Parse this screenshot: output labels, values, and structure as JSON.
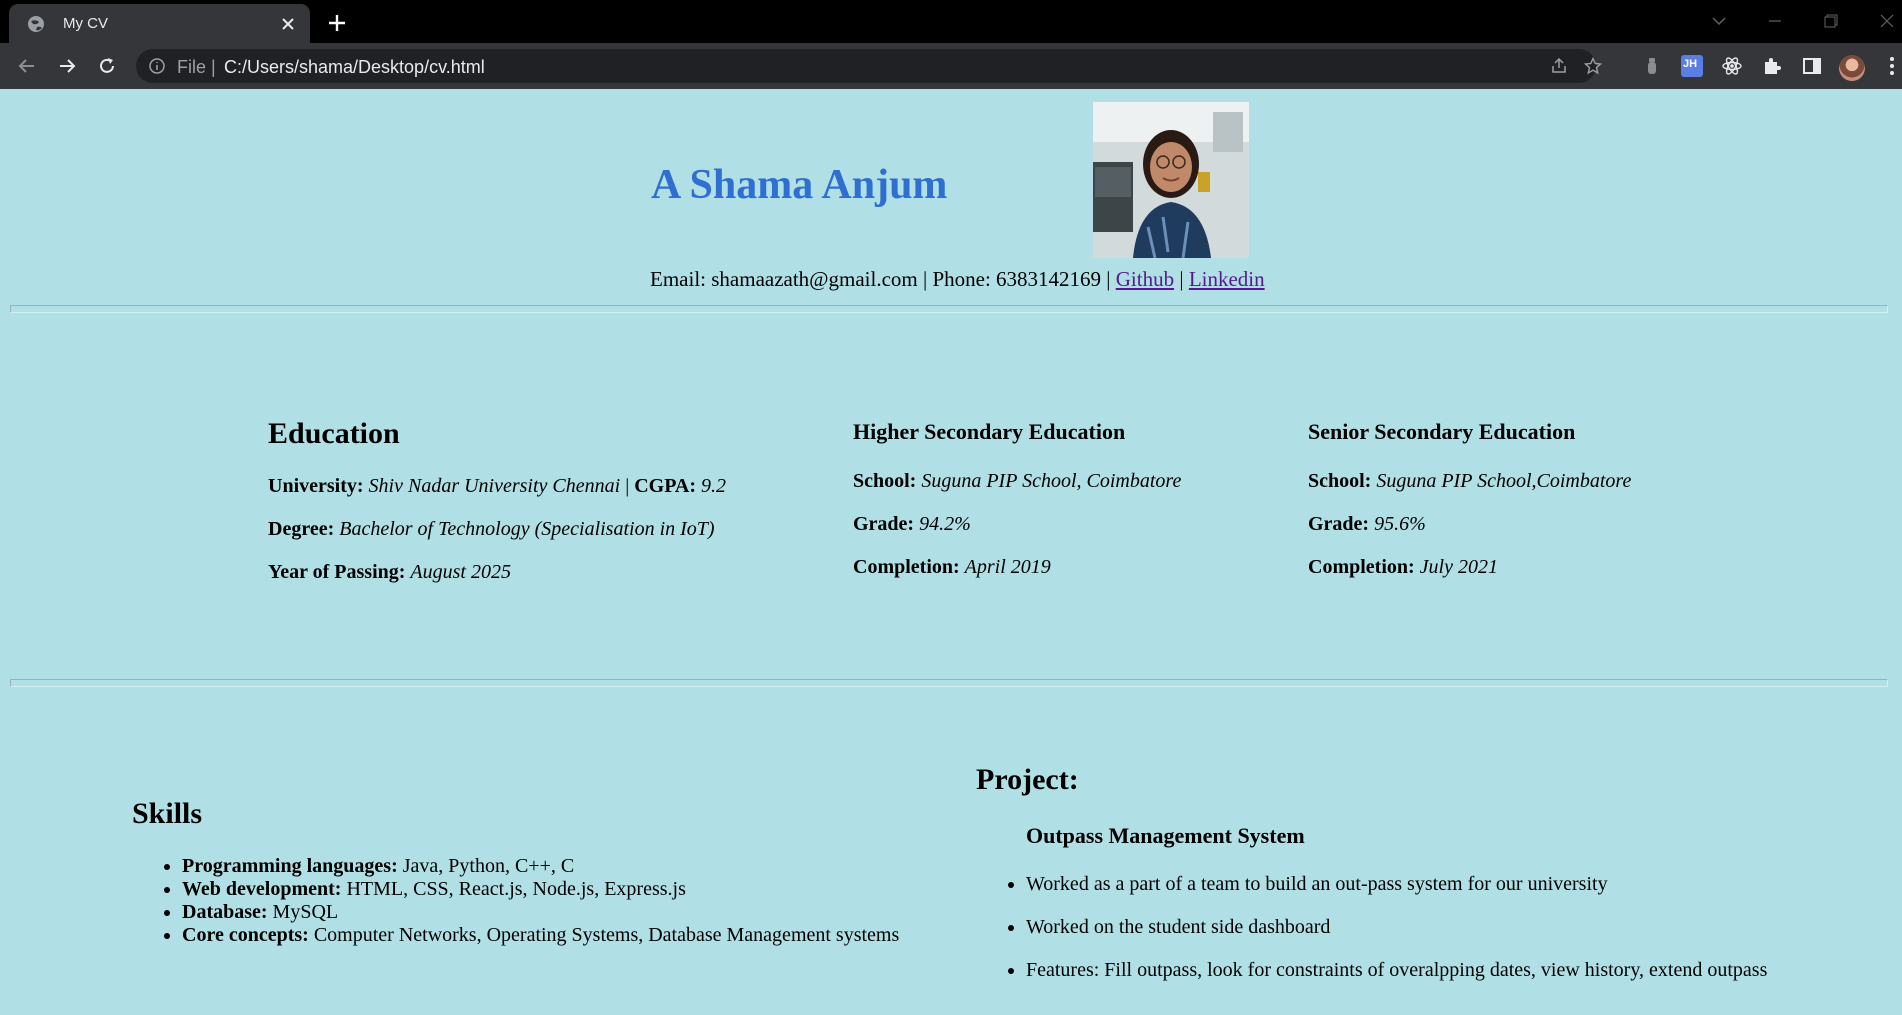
{
  "browser": {
    "tab_title": "My CV",
    "url_scheme": "File",
    "url_separator": "|",
    "url": "C:/Users/shama/Desktop/cv.html",
    "extension_jh_label": "JH"
  },
  "header": {
    "name": "A Shama Anjum",
    "email_text": "Email: shamaazath@gmail.com | Phone: 6383142169 |",
    "sep": "|",
    "github_label": "Github",
    "linkedin_label": "Linkedin"
  },
  "education": {
    "title": "Education",
    "university_label": "University:",
    "university_value": "Shiv Nadar University Chennai",
    "pipe": "|",
    "cgpa_label": "CGPA:",
    "cgpa_value": "9.2",
    "degree_label": "Degree:",
    "degree_value": "Bachelor of Technology (Specialisation in IoT)",
    "year_label": "Year of Passing:",
    "year_value": "August 2025"
  },
  "higher_secondary": {
    "title": "Higher Secondary Education",
    "school_label": "School:",
    "school_value": "Suguna PIP School, Coimbatore",
    "grade_label": "Grade:",
    "grade_value": "94.2%",
    "completion_label": "Completion:",
    "completion_value": "April 2019"
  },
  "senior_secondary": {
    "title": "Senior Secondary Education",
    "school_label": "School:",
    "school_value": "Suguna PIP School,Coimbatore",
    "grade_label": "Grade:",
    "grade_value": "95.6%",
    "completion_label": "Completion:",
    "completion_value": "July 2021"
  },
  "skills": {
    "title": "Skills",
    "items": [
      {
        "label": "Programming languages:",
        "value": "Java, Python, C++, C"
      },
      {
        "label": "Web development:",
        "value": "HTML, CSS, React.js, Node.js, Express.js"
      },
      {
        "label": "Database:",
        "value": "MySQL"
      },
      {
        "label": "Core concepts:",
        "value": "Computer Networks, Operating Systems, Database Management systems"
      }
    ]
  },
  "project": {
    "title": "Project:",
    "name": "Outpass Management System",
    "items": [
      "Worked as a part of a team to build an out-pass system for our university",
      "Worked on the student side dashboard",
      "Features: Fill outpass, look for constraints of overalpping dates, view history, extend outpass"
    ]
  },
  "colors": {
    "page_background": "#b0dfe5",
    "name_color": "#2f6fd1",
    "link_color": "#551a8b"
  }
}
